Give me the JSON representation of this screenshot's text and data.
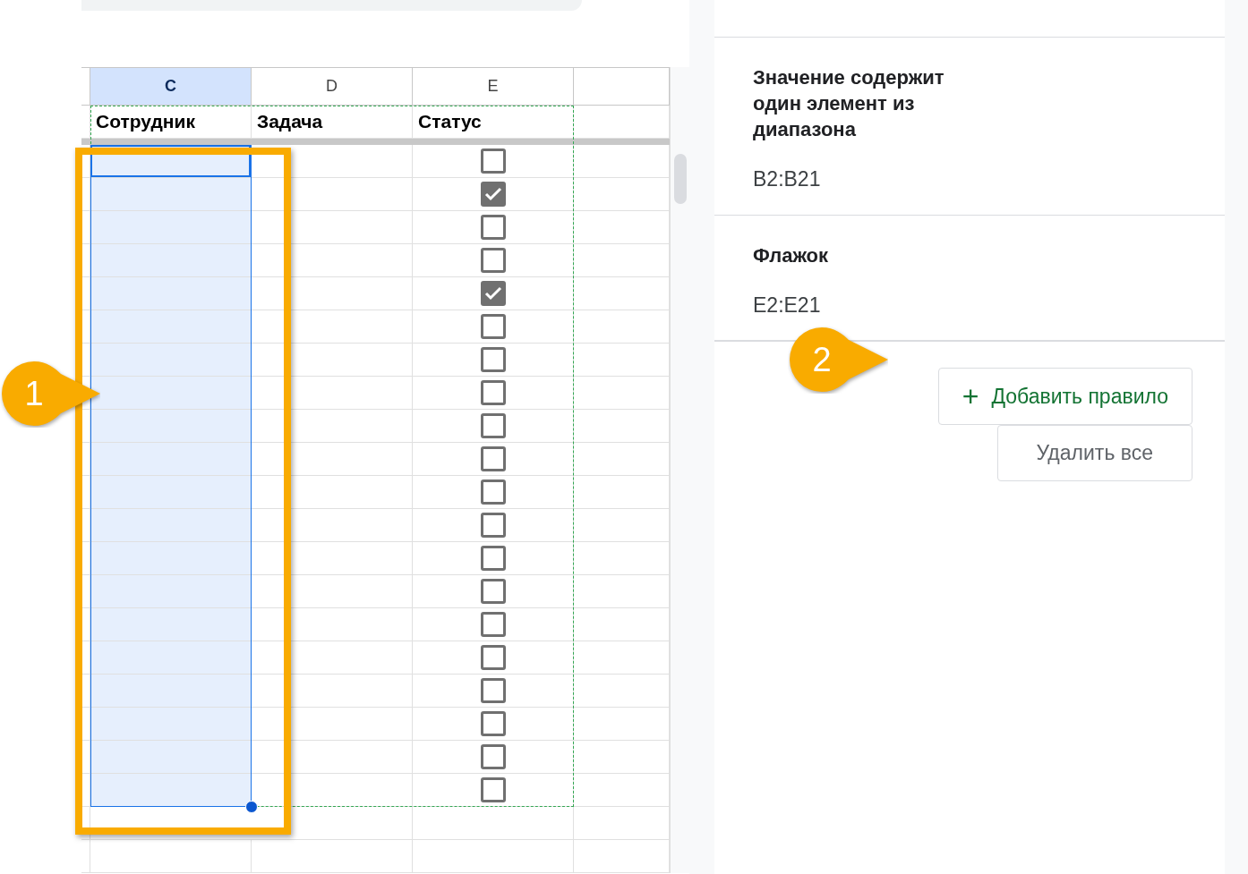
{
  "columns": [
    {
      "label": "C",
      "selected": true
    },
    {
      "label": "D",
      "selected": false
    },
    {
      "label": "E",
      "selected": false
    }
  ],
  "header_row": [
    "Сотрудник",
    "Задача",
    "Статус"
  ],
  "status_checkboxes": [
    {
      "checked": false
    },
    {
      "checked": true
    },
    {
      "checked": false
    },
    {
      "checked": false
    },
    {
      "checked": true
    },
    {
      "checked": false
    },
    {
      "checked": false
    },
    {
      "checked": false
    },
    {
      "checked": false
    },
    {
      "checked": false
    },
    {
      "checked": false
    },
    {
      "checked": false
    },
    {
      "checked": false
    },
    {
      "checked": false
    },
    {
      "checked": false
    },
    {
      "checked": false
    },
    {
      "checked": false
    },
    {
      "checked": false
    },
    {
      "checked": false
    },
    {
      "checked": false
    }
  ],
  "rules": [
    {
      "condition": "Значение содержит один элемент из диапазона",
      "range": "B2:B21"
    },
    {
      "condition": "Флажок",
      "range": "E2:E21"
    }
  ],
  "buttons": {
    "add_icon": "+",
    "add": "Добавить правило",
    "delete_all": "Удалить все"
  },
  "callouts": [
    "1",
    "2"
  ]
}
